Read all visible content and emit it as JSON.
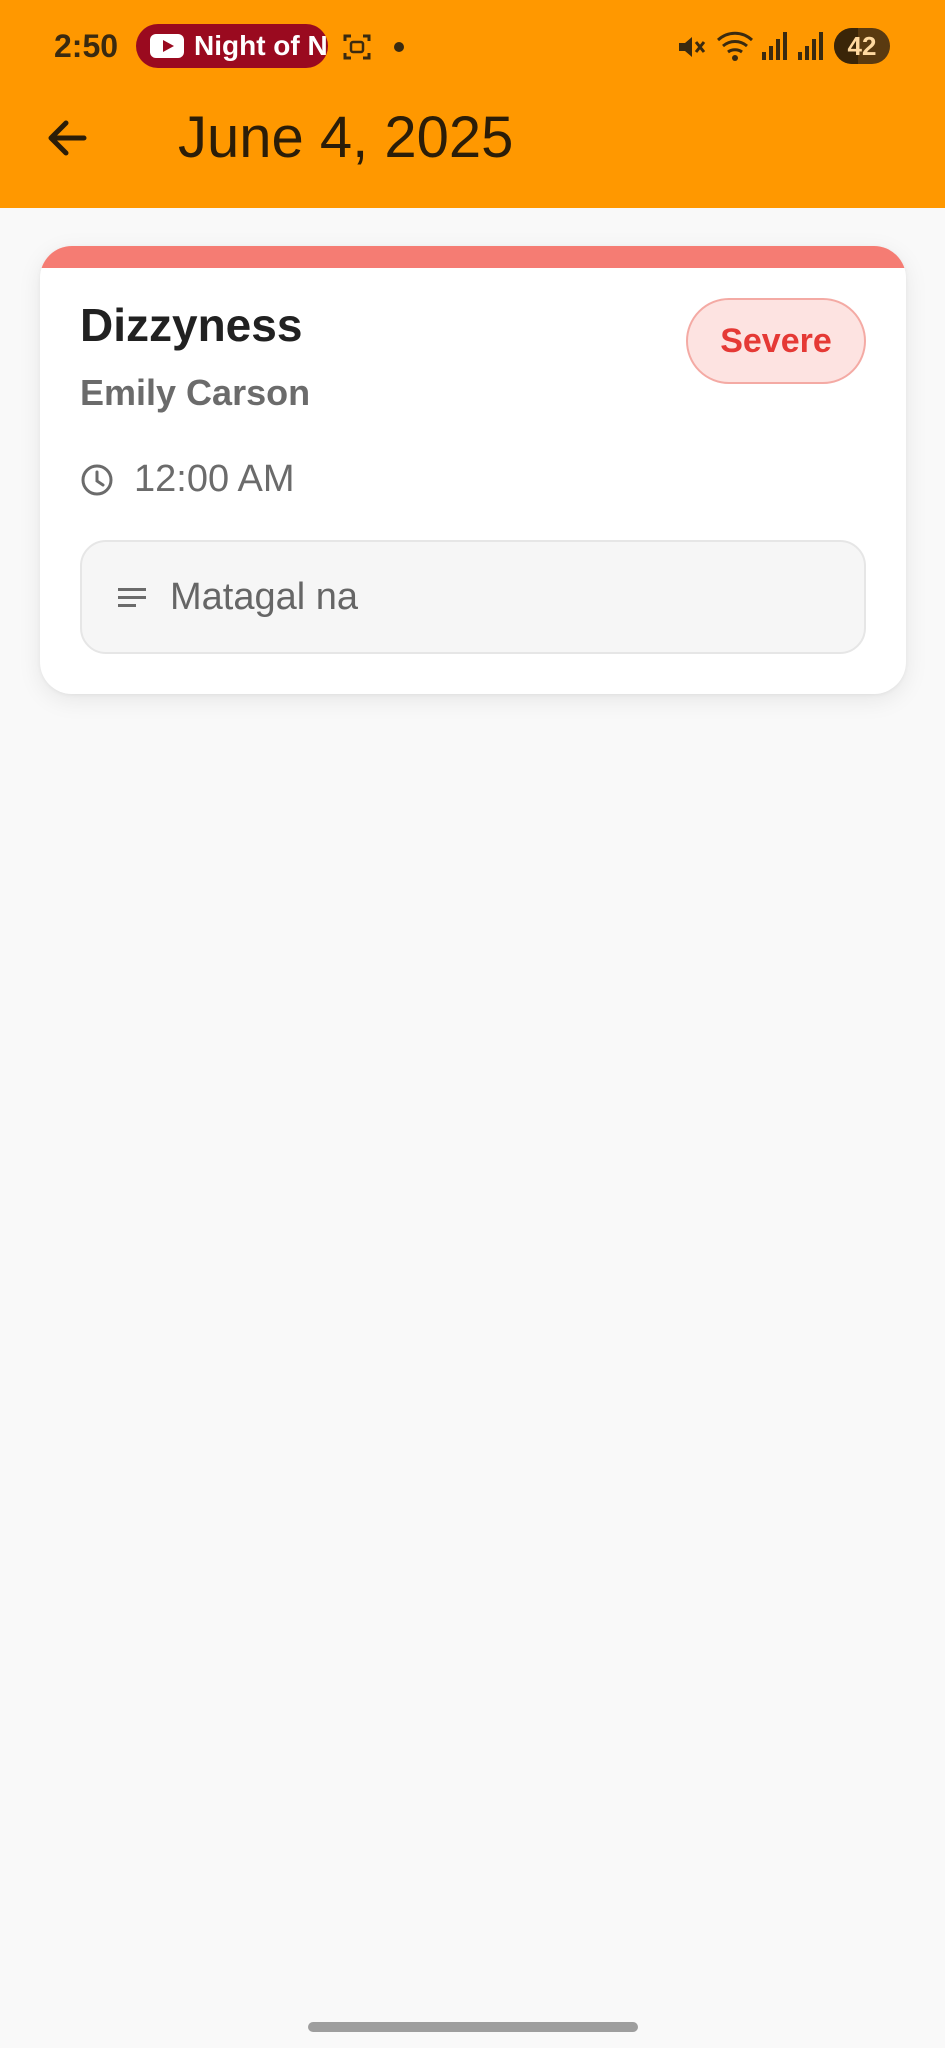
{
  "status_bar": {
    "time": "2:50",
    "media_pill_text": "Night of N",
    "battery": "42"
  },
  "toolbar": {
    "title": "June 4, 2025",
    "back_icon": "arrow-back-icon"
  },
  "entry": {
    "symptom": "Dizzyness",
    "patient": "Emily Carson",
    "severity": "Severe",
    "time": "12:00 AM",
    "note": "Matagal na",
    "accent_color": "#f57c73"
  },
  "colors": {
    "appbar": "#ff9800",
    "background": "#f9f9f9",
    "severity_text": "#e53935"
  }
}
